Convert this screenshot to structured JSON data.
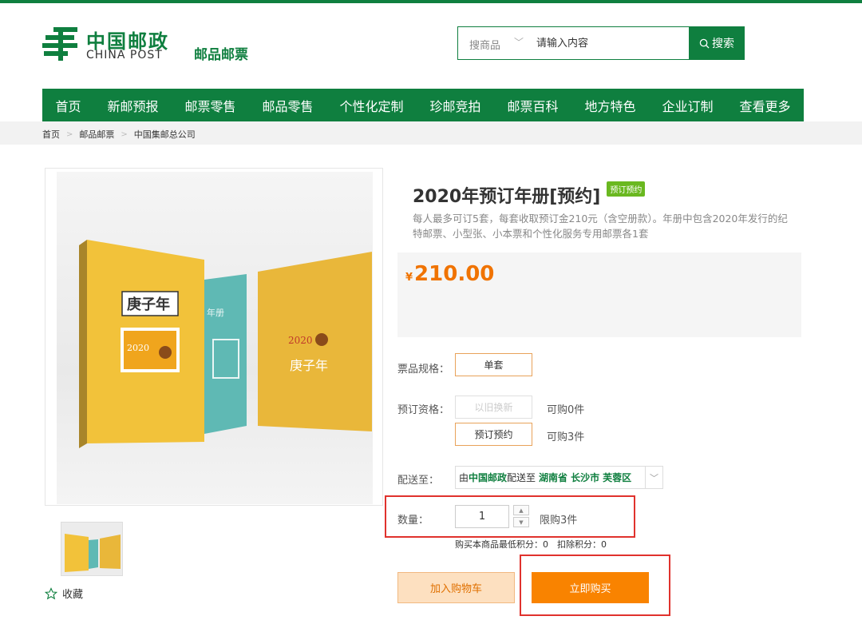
{
  "header": {
    "logo_cn": "中国邮政",
    "logo_en": "CHINA POST",
    "logo_sub": "邮品邮票"
  },
  "search": {
    "category": "搜商品",
    "placeholder": "请输入内容",
    "button_label": "搜索"
  },
  "nav": {
    "items": [
      "首页",
      "新邮预报",
      "邮票零售",
      "邮品零售",
      "个性化定制",
      "珍邮竞拍",
      "邮票百科",
      "地方特色",
      "企业订制",
      "查看更多"
    ]
  },
  "breadcrumb": [
    "首页",
    "邮品邮票",
    "中国集邮总公司"
  ],
  "product": {
    "title": "2020年预订年册[预约]",
    "tag": "预订预约",
    "description": "每人最多可订5套，每套收取预订金210元（含空册款）。年册中包含2020年发行的纪特邮票、小型张、小本票和个性化服务专用邮票各1套",
    "price_symbol": "¥",
    "price": "210.00",
    "image_texts": {
      "cover_title": "庚子年",
      "year": "2020",
      "spine": "年册"
    }
  },
  "specs": {
    "label": "票品规格：",
    "option": "单套"
  },
  "qualification": {
    "label": "预订资格：",
    "options": [
      {
        "label": "以旧换新",
        "note": "可购0件"
      },
      {
        "label": "预订预约",
        "note": "可购3件"
      }
    ]
  },
  "delivery": {
    "label": "配送至：",
    "prefix": "由",
    "carrier": "中国邮政",
    "middle": "配送至",
    "province": "湖南省",
    "city": "长沙市",
    "district": "芙蓉区"
  },
  "quantity": {
    "label": "数量：",
    "value": "1",
    "limit": "限购3件",
    "points": "购买本商品最低积分：0　扣除积分：0"
  },
  "actions": {
    "add_cart": "加入购物车",
    "buy_now": "立即购买"
  },
  "favorite": {
    "label": "收藏"
  },
  "colors": {
    "brand_green": "#0f7f3f",
    "price_orange": "#f07300",
    "buy_orange": "#f98300",
    "highlight_red": "#e0322d"
  }
}
